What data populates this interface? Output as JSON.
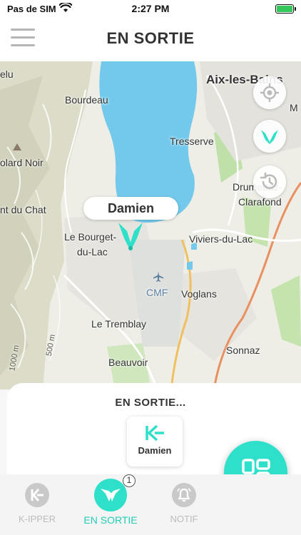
{
  "status_bar": {
    "carrier": "Pas de SIM",
    "time": "2:27 PM"
  },
  "header": {
    "title": "EN SORTIE"
  },
  "map": {
    "labels": {
      "aix": "Aix-les-Bains",
      "bourdeau": "Bourdeau",
      "elu": "elu",
      "tresserve": "Tresserve",
      "olard_noir": "olard Noir",
      "drumettaz": "Drumettaz-",
      "clarafond": "Clarafond",
      "dent_du_chat": "nt du Chat",
      "le_bourget": "Le Bourget-",
      "du_lac": "du-Lac",
      "viviers": "Viviers-du-Lac",
      "cmf": "CMF",
      "voglans": "Voglans",
      "le_tremblay": "Le Tremblay",
      "sonnaz": "Sonnaz",
      "beauvoir": "Beauvoir",
      "m": "M",
      "elev_500": "500 m",
      "elev_1000": "1000 m"
    },
    "marker_name": "Damien"
  },
  "panel": {
    "title": "EN SORTIE...",
    "person": {
      "name": "Damien"
    }
  },
  "tabs": [
    {
      "label": "K-IPPER",
      "active": false
    },
    {
      "label": "EN SORTIE",
      "active": true,
      "badge": "1"
    },
    {
      "label": "NOTIF",
      "active": false
    }
  ],
  "colors": {
    "accent": "#2ee0c9",
    "lake": "#73c9ec",
    "inactive": "#c9c9c9"
  },
  "icons": [
    "wifi-icon",
    "battery-icon",
    "menu-icon",
    "locate-icon",
    "kipper-marker-icon",
    "history-icon",
    "grid-icon",
    "k-logo-icon",
    "bell-icon"
  ]
}
